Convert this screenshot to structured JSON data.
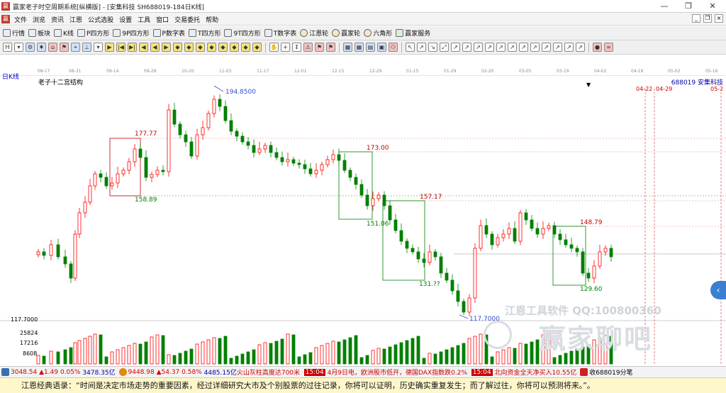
{
  "window": {
    "title": "赢家老子时空周期系统[纵横版] - [安集科技  SH688019-184日K线]",
    "minimize": "—",
    "restore": "❐",
    "close": "✕"
  },
  "menu": {
    "items": [
      "文件",
      "浏览",
      "资讯",
      "江恩",
      "公式选股",
      "设置",
      "工具",
      "窗口",
      "交易委托",
      "帮助"
    ],
    "mdi": [
      "_",
      "❐",
      "×"
    ]
  },
  "toolbar": [
    {
      "label": "行情",
      "icon": "grid-icon"
    },
    {
      "label": "板块",
      "icon": "blocks-icon"
    },
    {
      "label": "K线",
      "icon": "kline-icon"
    },
    {
      "label": "P四方形",
      "icon": "p-square-icon"
    },
    {
      "label": "9P四方形",
      "icon": "9p-square-icon"
    },
    {
      "label": "P数字表",
      "icon": "p-table-icon"
    },
    {
      "label": "T四方形",
      "icon": "t-square-icon"
    },
    {
      "label": "9T四方形",
      "icon": "9t-square-icon"
    },
    {
      "label": "T数字表",
      "icon": "t-table-icon"
    },
    {
      "label": "江恩轮",
      "icon": "gann-wheel-icon"
    },
    {
      "label": "赢家轮",
      "icon": "winner-wheel-icon"
    },
    {
      "label": "六角形",
      "icon": "hexagon-icon"
    },
    {
      "label": "赢家服务",
      "icon": "dollar-icon"
    }
  ],
  "chart_header": {
    "period": "日K线",
    "structure": "老子十二宫结构",
    "stock": "688019  安集科技"
  },
  "date_axis": [
    "08-17",
    "08-31",
    "09-14",
    "09-28",
    "10-20",
    "11-03",
    "11-17",
    "12-01",
    "12-15",
    "12-29",
    "01-15",
    "01-29",
    "02-20",
    "03-05",
    "03-19",
    "04-02",
    "04-16",
    "05-02",
    "05-16"
  ],
  "cycle_dates": [
    "04-22",
    "04-29",
    "05-2"
  ],
  "price_labels": {
    "high": "194.8500",
    "low": "117.7000",
    "box1_top": "177.77",
    "box1_bottom": "158.89",
    "box2_top": "173.00",
    "box3_top": "157.17",
    "box3_mid": "151.06",
    "box4_bottom": "131.??",
    "box5_top": "148.79",
    "box5_bottom": "129.60"
  },
  "volume_axis": [
    "117.7000",
    "25824",
    "17216",
    "8608"
  ],
  "watermark": {
    "line1": "江恩工具软件 QQ:100800360",
    "line2": "赢家聊吧"
  },
  "status": {
    "sh_index": "3048.54",
    "sh_change": "▲1.49",
    "sh_pct": "0.05%",
    "sh_amount": "3478.35亿",
    "sz_index": "9448.98",
    "sz_change": "▲54.37",
    "sz_pct": "0.58%",
    "sz_amount": "4485.15亿",
    "news1": "火山灰柱高度达700米",
    "time": "15:04",
    "news2": "4月9日电，欧洲股市低开，德国DAX指数跌0.2%",
    "time2": "15:04",
    "news3": "北向资金全天净买入10.55亿",
    "collect": "收688019分笔"
  },
  "quote": "江恩经典语录：“时间是决定市场走势的重要因素，经过详细研究大市及个别股票的过往记录，你将可以证明，历史确实重复发生；而了解过往，你将可以预测将来。”。",
  "chart_data": {
    "type": "candlestick",
    "title": "",
    "high_price": 194.85,
    "low_price": 117.7,
    "levels": [
      177.77,
      158.89,
      173.0,
      157.17,
      151.06,
      148.79,
      129.6
    ],
    "volume_ticks": [
      25824,
      17216,
      8608
    ],
    "colors": {
      "up": "#ff0000",
      "down": "#008000",
      "box_up": "#c00000",
      "box_down": "#008000"
    }
  }
}
